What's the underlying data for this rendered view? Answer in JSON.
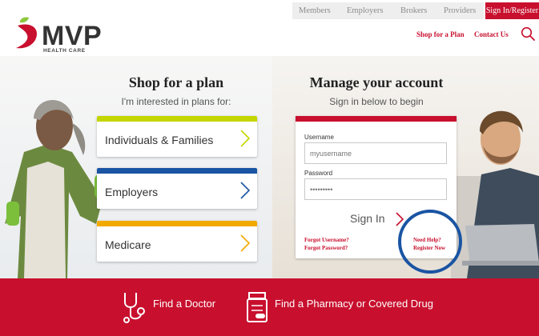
{
  "topnav": {
    "links": [
      "Members",
      "Employers",
      "Brokers",
      "Providers"
    ],
    "signin_register": "Sign In/Register"
  },
  "brand": {
    "logo_text": "MVP",
    "logo_sub": "HEALTH CARE",
    "primary_color": "#c8102e"
  },
  "header": {
    "shop_link": "Shop for a Plan",
    "contact_link": "Contact Us",
    "search_icon": "search-icon"
  },
  "shop": {
    "title": "Shop for a plan",
    "subtitle": "I'm interested in plans for:",
    "plans": [
      {
        "label": "Individuals & Families",
        "color": "#c4d600",
        "chevron_color": "#c4d600"
      },
      {
        "label": "Employers",
        "color": "#1a54a3",
        "chevron_color": "#1a54a3"
      },
      {
        "label": "Medicare",
        "color": "#f2a900",
        "chevron_color": "#f2a900"
      }
    ]
  },
  "account": {
    "title": "Manage your account",
    "subtitle": "Sign in below to begin",
    "username_label": "Username",
    "username_placeholder": "myusername",
    "password_label": "Password",
    "password_placeholder": "•••••••••",
    "signin_label": "Sign In",
    "forgot_username": "Forgot Username?",
    "forgot_password": "Forgot Password?",
    "need_help": "Need Help?",
    "register_now": "Register Now"
  },
  "footer": {
    "find_doctor": "Find a Doctor",
    "find_pharmacy": "Find a Pharmacy or Covered Drug"
  }
}
